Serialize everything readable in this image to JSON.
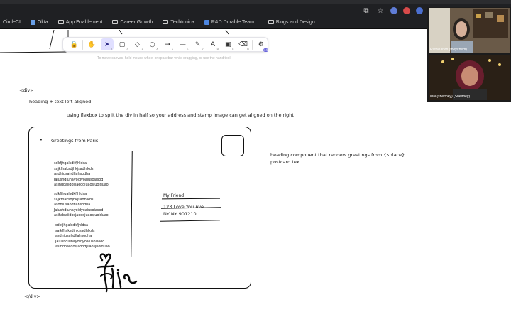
{
  "browser": {
    "bookmarks": [
      {
        "label": "CircleCI",
        "icon": "none"
      },
      {
        "label": "Okta",
        "icon": "okta-icon"
      },
      {
        "label": "App Enablement",
        "icon": "folder-icon"
      },
      {
        "label": "Career Growth",
        "icon": "folder-icon"
      },
      {
        "label": "Techtonica",
        "icon": "folder-icon"
      },
      {
        "label": "R&D Durable Team...",
        "icon": "doc-icon"
      },
      {
        "label": "Blogs and Design...",
        "icon": "folder-icon"
      }
    ]
  },
  "toolbar": {
    "hint": "To move canvas, hold mouse wheel or spacebar while dragging, or use the hand tool",
    "badge": "44",
    "tools": [
      {
        "name": "lock",
        "glyph": "🔒",
        "key": ""
      },
      {
        "name": "hand",
        "glyph": "✋",
        "key": ""
      },
      {
        "name": "selection",
        "glyph": "➤",
        "key": "1"
      },
      {
        "name": "rectangle",
        "glyph": "▢",
        "key": "2"
      },
      {
        "name": "diamond",
        "glyph": "◇",
        "key": "3"
      },
      {
        "name": "ellipse",
        "glyph": "○",
        "key": "4"
      },
      {
        "name": "arrow",
        "glyph": "→",
        "key": "5"
      },
      {
        "name": "line",
        "glyph": "—",
        "key": "6"
      },
      {
        "name": "draw",
        "glyph": "✎",
        "key": "7"
      },
      {
        "name": "text",
        "glyph": "A",
        "key": "8"
      },
      {
        "name": "image",
        "glyph": "▣",
        "key": "9"
      },
      {
        "name": "eraser",
        "glyph": "⌫",
        "key": "0"
      },
      {
        "name": "library",
        "glyph": "⚙",
        "key": ""
      }
    ]
  },
  "canvas": {
    "div_open": "<div>",
    "div_close": "</div>",
    "note_heading": "heading + text left aligned",
    "note_flexbox": "using flexbox to split the div in half so your address and stamp image can get aligned on the right",
    "note_component_1": "heading component that renders greetings from {$place}",
    "note_component_2": "postcard text",
    "postcard": {
      "greeting": "Greetings from Paris!",
      "paragraphs": [
        [
          "sdkfjhgalsdkfjhldsa",
          "sajkfhaksdjhkjsadhlkds",
          "asdhiusahdfiahsodha",
          "Jaiushdiuhayoidyoaiusoiasod",
          "asihdoaiidosjaoodjuaosjuoiduao"
        ],
        [
          "sdkfjhgalsdkfjhldsa",
          "sajkfhaksdjhkjsadhlkds",
          "asdhiusahdfiahsodha",
          "Jaiushdiuhayoidyoaiusoiasod",
          "asihdoaiidosjaoodjuaosjuoiduao"
        ],
        [
          "sdkfjhgalsdkfjhldsa",
          "sajkfhaksdjhkjsadhlkds",
          "asdhiusahdfiahsodha",
          "Jaiushdiuhayoidyoaiusoiasod",
          "asihdoaiidosjaoodjuaosjuoiduao"
        ]
      ],
      "address": {
        "name": "My Friend",
        "street": "123 Love You Ave",
        "city": "NY,NY 901210"
      }
    }
  },
  "video": {
    "participants": [
      {
        "name": "Ruthie Irvin (they/them)"
      },
      {
        "name": "Mai (she/they) (She/they)"
      }
    ]
  }
}
